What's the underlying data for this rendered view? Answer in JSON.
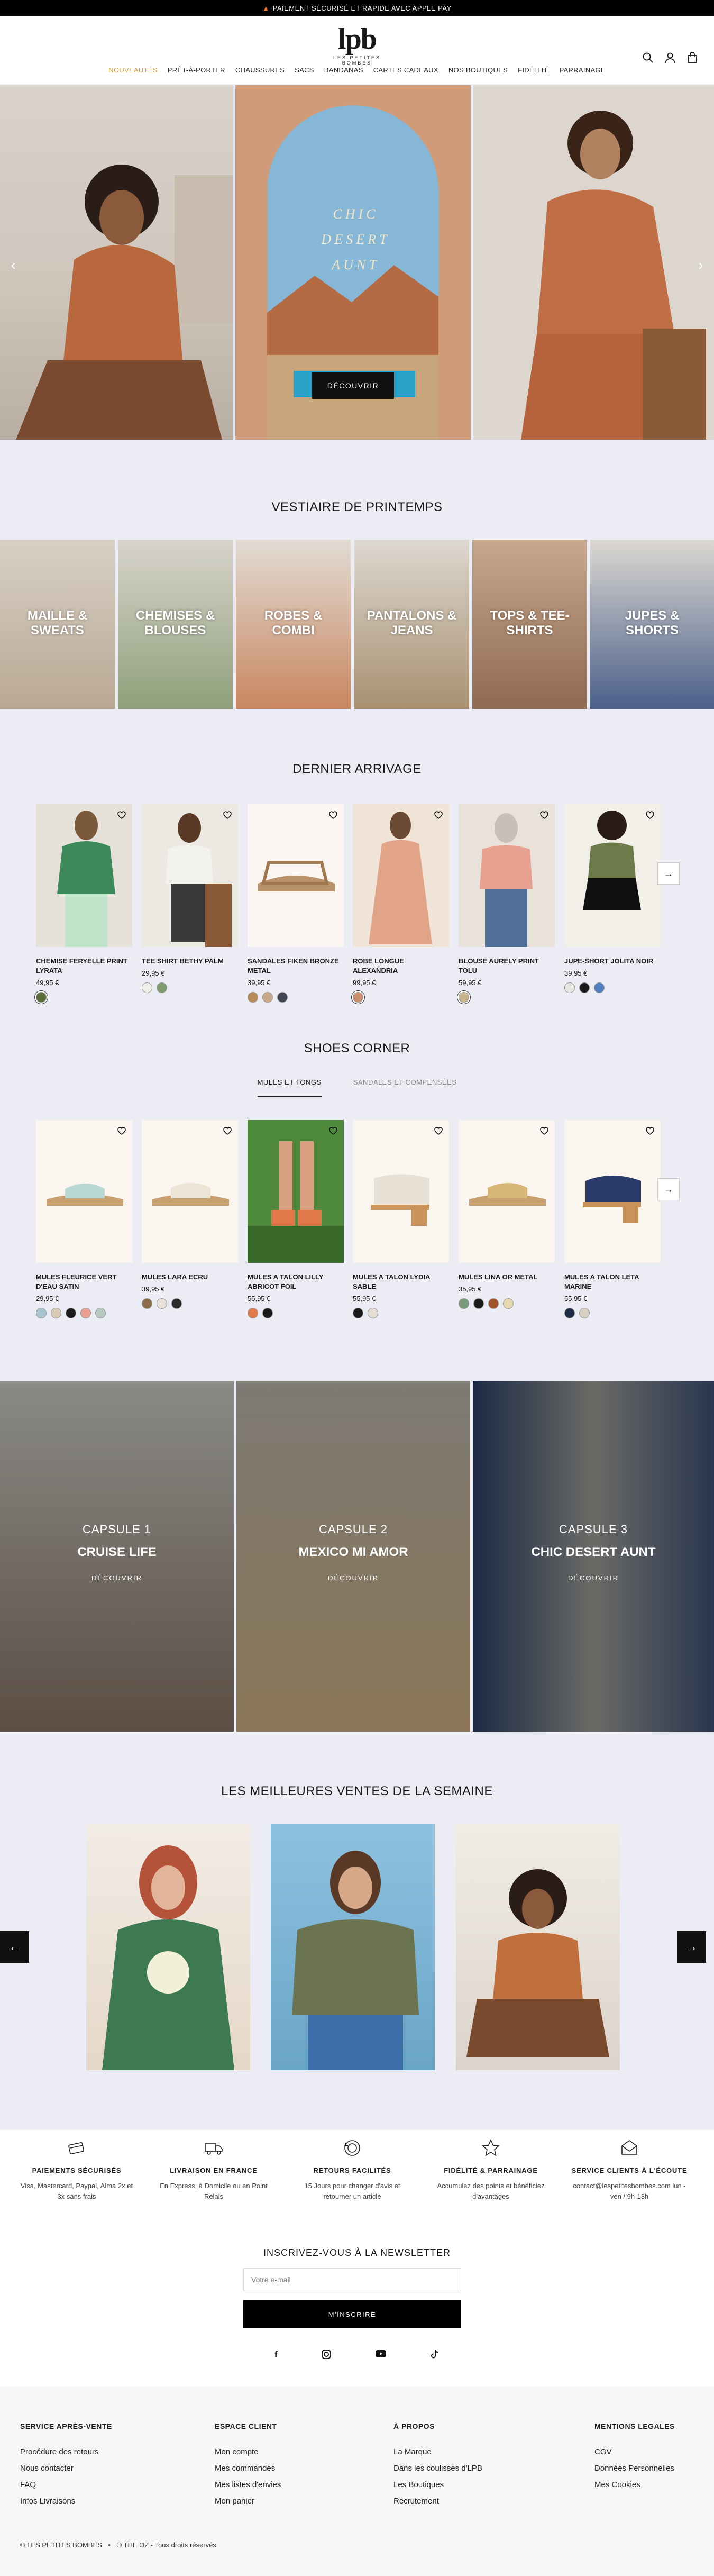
{
  "announcement": {
    "icon": "flame-icon",
    "text": "PAIEMENT SÉCURISÉ ET RAPIDE AVEC APPLE PAY"
  },
  "header": {
    "logo": "lpb",
    "logo_sub": "LES PETITES BOMBES",
    "nav": [
      "NOUVEAUTÉS",
      "PRÊT-À-PORTER",
      "CHAUSSURES",
      "SACS",
      "BANDANAS",
      "CARTES CADEAUX",
      "NOS BOUTIQUES",
      "FIDÉLITÉ",
      "PARRAINAGE"
    ],
    "nav_active_color": "#d39b3b",
    "icons": [
      "search-icon",
      "account-icon",
      "bag-icon"
    ]
  },
  "hero": {
    "title_lines": [
      "CHIC",
      "DESERT",
      "AUNT"
    ],
    "cta": "DÉCOUVRIR"
  },
  "wardrobe": {
    "title": "VESTIAIRE DE PRINTEMPS",
    "categories": [
      "MAILLE & SWEATS",
      "CHEMISES & BLOUSES",
      "ROBES & COMBI",
      "PANTALONS & JEANS",
      "TOPS & TEE-SHIRTS",
      "JUPES & SHORTS"
    ]
  },
  "new_arrivals": {
    "title": "DERNIER ARRIVAGE",
    "products": [
      {
        "name": "CHEMISE FERYELLE PRINT LYRATA",
        "price": "49,95 €",
        "swatches": [
          "#5a6e3a"
        ]
      },
      {
        "name": "TEE SHIRT BETHY PALM",
        "price": "29,95 €",
        "swatches": [
          "#f2f0ea",
          "#7f9c6e"
        ]
      },
      {
        "name": "SANDALES FIKEN BRONZE METAL",
        "price": "39,95 €",
        "swatches": [
          "#b88a5a",
          "#c9a88a",
          "#444654"
        ]
      },
      {
        "name": "ROBE LONGUE ALEXANDRIA",
        "price": "99,95 €",
        "swatches": [
          "#c98e6e"
        ]
      },
      {
        "name": "BLOUSE AURELY PRINT TOLU",
        "price": "59,95 €",
        "swatches": [
          "#c7b48a"
        ]
      },
      {
        "name": "JUPE-SHORT JOLITA NOIR",
        "price": "39,95 €",
        "swatches": [
          "#e8e6e2",
          "#1a1a1a",
          "#4f7fbf"
        ]
      }
    ]
  },
  "shoes": {
    "title": "SHOES CORNER",
    "tabs": [
      "MULES ET TONGS",
      "SANDALES ET COMPENSÉES"
    ],
    "products": [
      {
        "name": "MULES FLEURICE VERT D'EAU SATIN",
        "price": "29,95 €",
        "swatches": [
          "#a8c4cf",
          "#d9cbb8",
          "#1a1a1a",
          "#e8a090",
          "#b6c9c0"
        ]
      },
      {
        "name": "MULES LARA ECRU",
        "price": "39,95 €",
        "swatches": [
          "#8a6d4a",
          "#e8e3d6",
          "#2a2a2a"
        ]
      },
      {
        "name": "MULES A TALON LILLY ABRICOT FOIL",
        "price": "55,95 €",
        "swatches": [
          "#e07a4a",
          "#1a1a1a"
        ]
      },
      {
        "name": "MULES A TALON LYDIA SABLE",
        "price": "55,95 €",
        "swatches": [
          "#1a1a1a",
          "#e4ded2"
        ]
      },
      {
        "name": "MULES LINA OR METAL",
        "price": "35,95 €",
        "swatches": [
          "#7a9a7a",
          "#1a1a1a",
          "#a0522d",
          "#e8d8b0"
        ]
      },
      {
        "name": "MULES A TALON LETA MARINE",
        "price": "55,95 €",
        "swatches": [
          "#1f2a44",
          "#d8cfc2"
        ]
      }
    ]
  },
  "capsules": [
    {
      "kicker": "CAPSULE 1",
      "title": "CRUISE LIFE",
      "cta": "DÉCOUVRIR"
    },
    {
      "kicker": "CAPSULE 2",
      "title": "MEXICO MI AMOR",
      "cta": "DÉCOUVRIR"
    },
    {
      "kicker": "CAPSULE 3",
      "title": "CHIC DESERT AUNT",
      "cta": "DÉCOUVRIR"
    }
  ],
  "bestsellers": {
    "title": "LES MEILLEURES VENTES DE LA SEMAINE"
  },
  "features": [
    {
      "icon": "card-icon",
      "title": "PAIEMENTS SÉCURISÉS",
      "text": "Visa, Mastercard, Paypal, Alma 2x et 3x sans frais"
    },
    {
      "icon": "truck-icon",
      "title": "LIVRAISON EN FRANCE",
      "text": "En Express, à Domicile ou en Point Relais"
    },
    {
      "icon": "return-icon",
      "title": "RETOURS FACILITÉS",
      "text": "15 Jours pour changer d'avis et retourner un article"
    },
    {
      "icon": "star-icon",
      "title": "FIDÉLITÉ & PARRAINAGE",
      "text": "Accumulez des points et bénéficiez d'avantages"
    },
    {
      "icon": "mail-icon",
      "title": "SERVICE CLIENTS À L'ÉCOUTE",
      "text": "contact@lespetitesbombes.com lun - ven / 9h-13h"
    }
  ],
  "newsletter": {
    "title": "INSCRIVEZ-VOUS À LA NEWSLETTER",
    "placeholder": "Votre e-mail",
    "button": "M'INSCRIRE"
  },
  "social": [
    "facebook-icon",
    "instagram-icon",
    "youtube-icon",
    "tiktok-icon"
  ],
  "footer": {
    "columns": [
      {
        "title": "SERVICE APRÈS-VENTE",
        "links": [
          "Procédure des retours",
          "Nous contacter",
          "FAQ",
          "Infos Livraisons"
        ]
      },
      {
        "title": "ESPACE CLIENT",
        "links": [
          "Mon compte",
          "Mes commandes",
          "Mes listes d'envies",
          "Mon panier"
        ]
      },
      {
        "title": "À PROPOS",
        "links": [
          "La Marque",
          "Dans les coulisses d'LPB",
          "Les Boutiques",
          "Recrutement"
        ]
      },
      {
        "title": "MENTIONS LEGALES",
        "links": [
          "CGV",
          "Données Personnelles",
          "Mes Cookies"
        ]
      }
    ],
    "copyright": "© LES PETITES BOMBES",
    "credit": "© THE OZ - Tous droits réservés"
  }
}
